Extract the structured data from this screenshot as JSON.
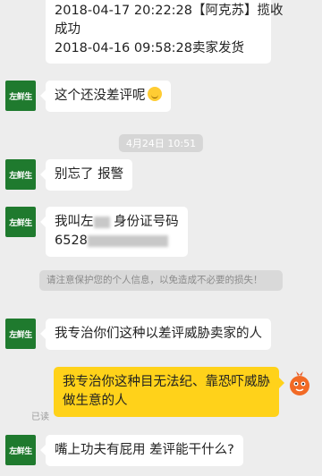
{
  "messages": {
    "shipping_line1": "2018-04-17 20:22:28【阿克苏】揽收",
    "shipping_line2": "成功",
    "shipping_line3": "2018-04-16 09:58:28卖家发货",
    "msg_no_bad_review": "这个还没差评呢",
    "timestamp": "4月24日 10:51",
    "msg_dont_forget": "别忘了  报警",
    "msg_name_prefix": "我叫左",
    "msg_name_suffix": " 身份证号码",
    "msg_id_prefix": "6528",
    "privacy_notice": "请注意保护您的个人信息，以免造成不必要的损失！",
    "msg_specialize": "我专治你们这种以差评威胁卖家的人",
    "reply_line1": "我专治你这种目无法纪、靠恐吓威胁",
    "reply_line2": "做生意的人",
    "read_status": "已读",
    "msg_last": "嘴上功夫有屁用  差评能干什么?"
  },
  "contact": {
    "avatar_text": "左鲜生"
  },
  "colors": {
    "avatar_bg": "#1f7a2e",
    "reply_bubble": "#ffd21a",
    "chat_bg": "#ededed"
  }
}
